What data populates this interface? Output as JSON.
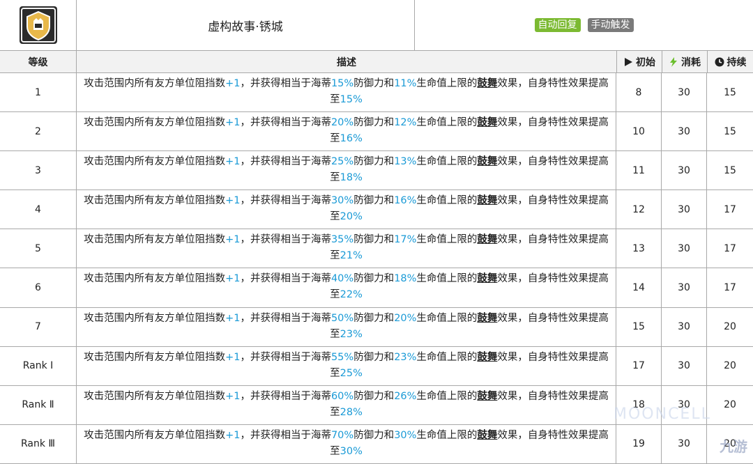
{
  "skill": {
    "icon": "tower-shield-icon",
    "name": "虚构故事·锈城",
    "tags": [
      "自动回复",
      "手动触发"
    ]
  },
  "headers": {
    "level": "等级",
    "description": "描述",
    "initial": "初始",
    "cost": "消耗",
    "duration": "持续"
  },
  "rows": [
    {
      "level": "1",
      "a": "15%",
      "b": "11%",
      "c": "15%",
      "init": "8",
      "cost": "30",
      "dur": "15"
    },
    {
      "level": "2",
      "a": "20%",
      "b": "12%",
      "c": "16%",
      "init": "10",
      "cost": "30",
      "dur": "15"
    },
    {
      "level": "3",
      "a": "25%",
      "b": "13%",
      "c": "18%",
      "init": "11",
      "cost": "30",
      "dur": "15"
    },
    {
      "level": "4",
      "a": "30%",
      "b": "16%",
      "c": "20%",
      "init": "12",
      "cost": "30",
      "dur": "17"
    },
    {
      "level": "5",
      "a": "35%",
      "b": "17%",
      "c": "21%",
      "init": "13",
      "cost": "30",
      "dur": "17"
    },
    {
      "level": "6",
      "a": "40%",
      "b": "18%",
      "c": "22%",
      "init": "14",
      "cost": "30",
      "dur": "17"
    },
    {
      "level": "7",
      "a": "50%",
      "b": "20%",
      "c": "23%",
      "init": "15",
      "cost": "30",
      "dur": "20"
    },
    {
      "level": "Rank Ⅰ",
      "a": "55%",
      "b": "23%",
      "c": "25%",
      "init": "17",
      "cost": "30",
      "dur": "20"
    },
    {
      "level": "Rank Ⅱ",
      "a": "60%",
      "b": "26%",
      "c": "28%",
      "init": "18",
      "cost": "30",
      "dur": "20"
    },
    {
      "level": "Rank Ⅲ",
      "a": "70%",
      "b": "30%",
      "c": "30%",
      "init": "19",
      "cost": "30",
      "dur": "20"
    }
  ],
  "desc_parts": {
    "p1": "攻击范围内所有友方单位阻挡数",
    "plus": "+1",
    "p2": "，并获得相当于海蒂",
    "p3": "防御力和",
    "p4": "生命值上限的",
    "keyword": "鼓舞",
    "p5": "效果，自身特性效果提高至"
  },
  "watermark": {
    "brand": "九游",
    "site": "MOONCELL"
  }
}
